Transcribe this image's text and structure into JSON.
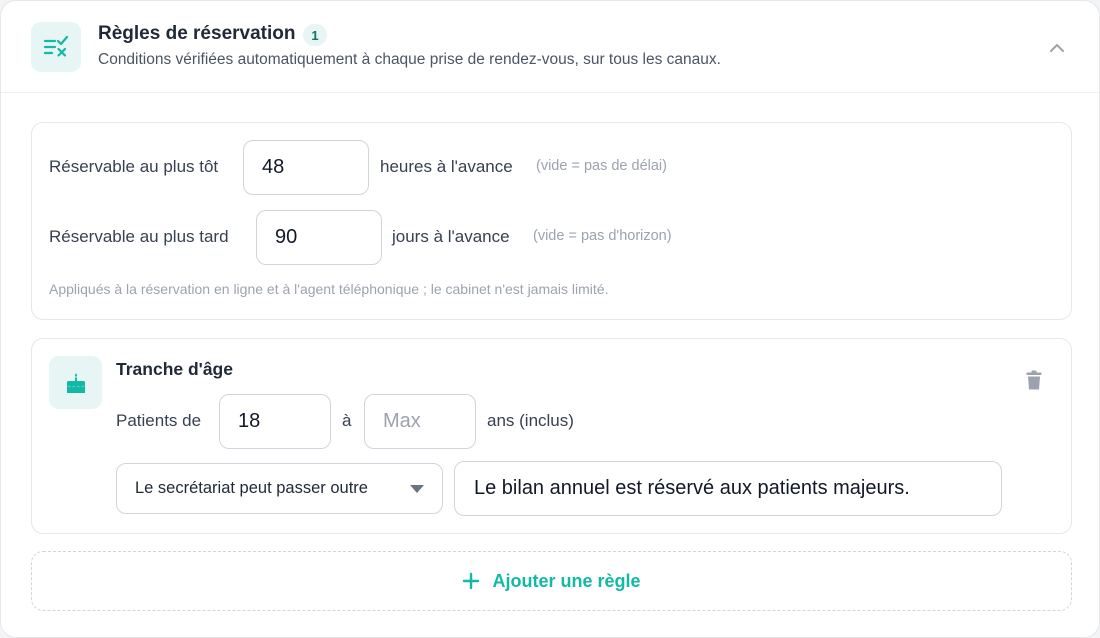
{
  "header": {
    "title": "Règles de réservation",
    "count": "1",
    "subtitle": "Conditions vérifiées automatiquement à chaque prise de rendez-vous, sur tous les canaux.",
    "icon": "list-check-icon",
    "collapse_icon": "chevron-up-icon"
  },
  "delays": {
    "earliest": {
      "label": "Réservable au plus tôt",
      "value": "48",
      "unit": "heures à l'avance",
      "hint": "(vide = pas de délai)"
    },
    "latest": {
      "label": "Réservable au plus tard",
      "value": "90",
      "unit": "jours à l'avance",
      "hint": "(vide = pas d'horizon)"
    },
    "note": "Appliqués à la réservation en ligne et à l'agent téléphonique ; le cabinet n'est jamais limité."
  },
  "age_rule": {
    "icon": "cake-icon",
    "title": "Tranche d'âge",
    "from_label": "Patients de",
    "min_value": "18",
    "to_label": "à",
    "max_placeholder": "Max",
    "max_value": "",
    "unit": "ans (inclus)",
    "override_option": "Le secrétariat peut passer outre",
    "message": "Le bilan annuel est réservé aux patients majeurs.",
    "delete_icon": "trash-icon"
  },
  "add_rule": {
    "label": "Ajouter une règle",
    "icon": "plus-icon"
  },
  "colors": {
    "accent": "#14b8a6",
    "accent_bg": "#e7f5f4",
    "border": "#e5e7eb",
    "muted_text": "#9ca3af"
  }
}
